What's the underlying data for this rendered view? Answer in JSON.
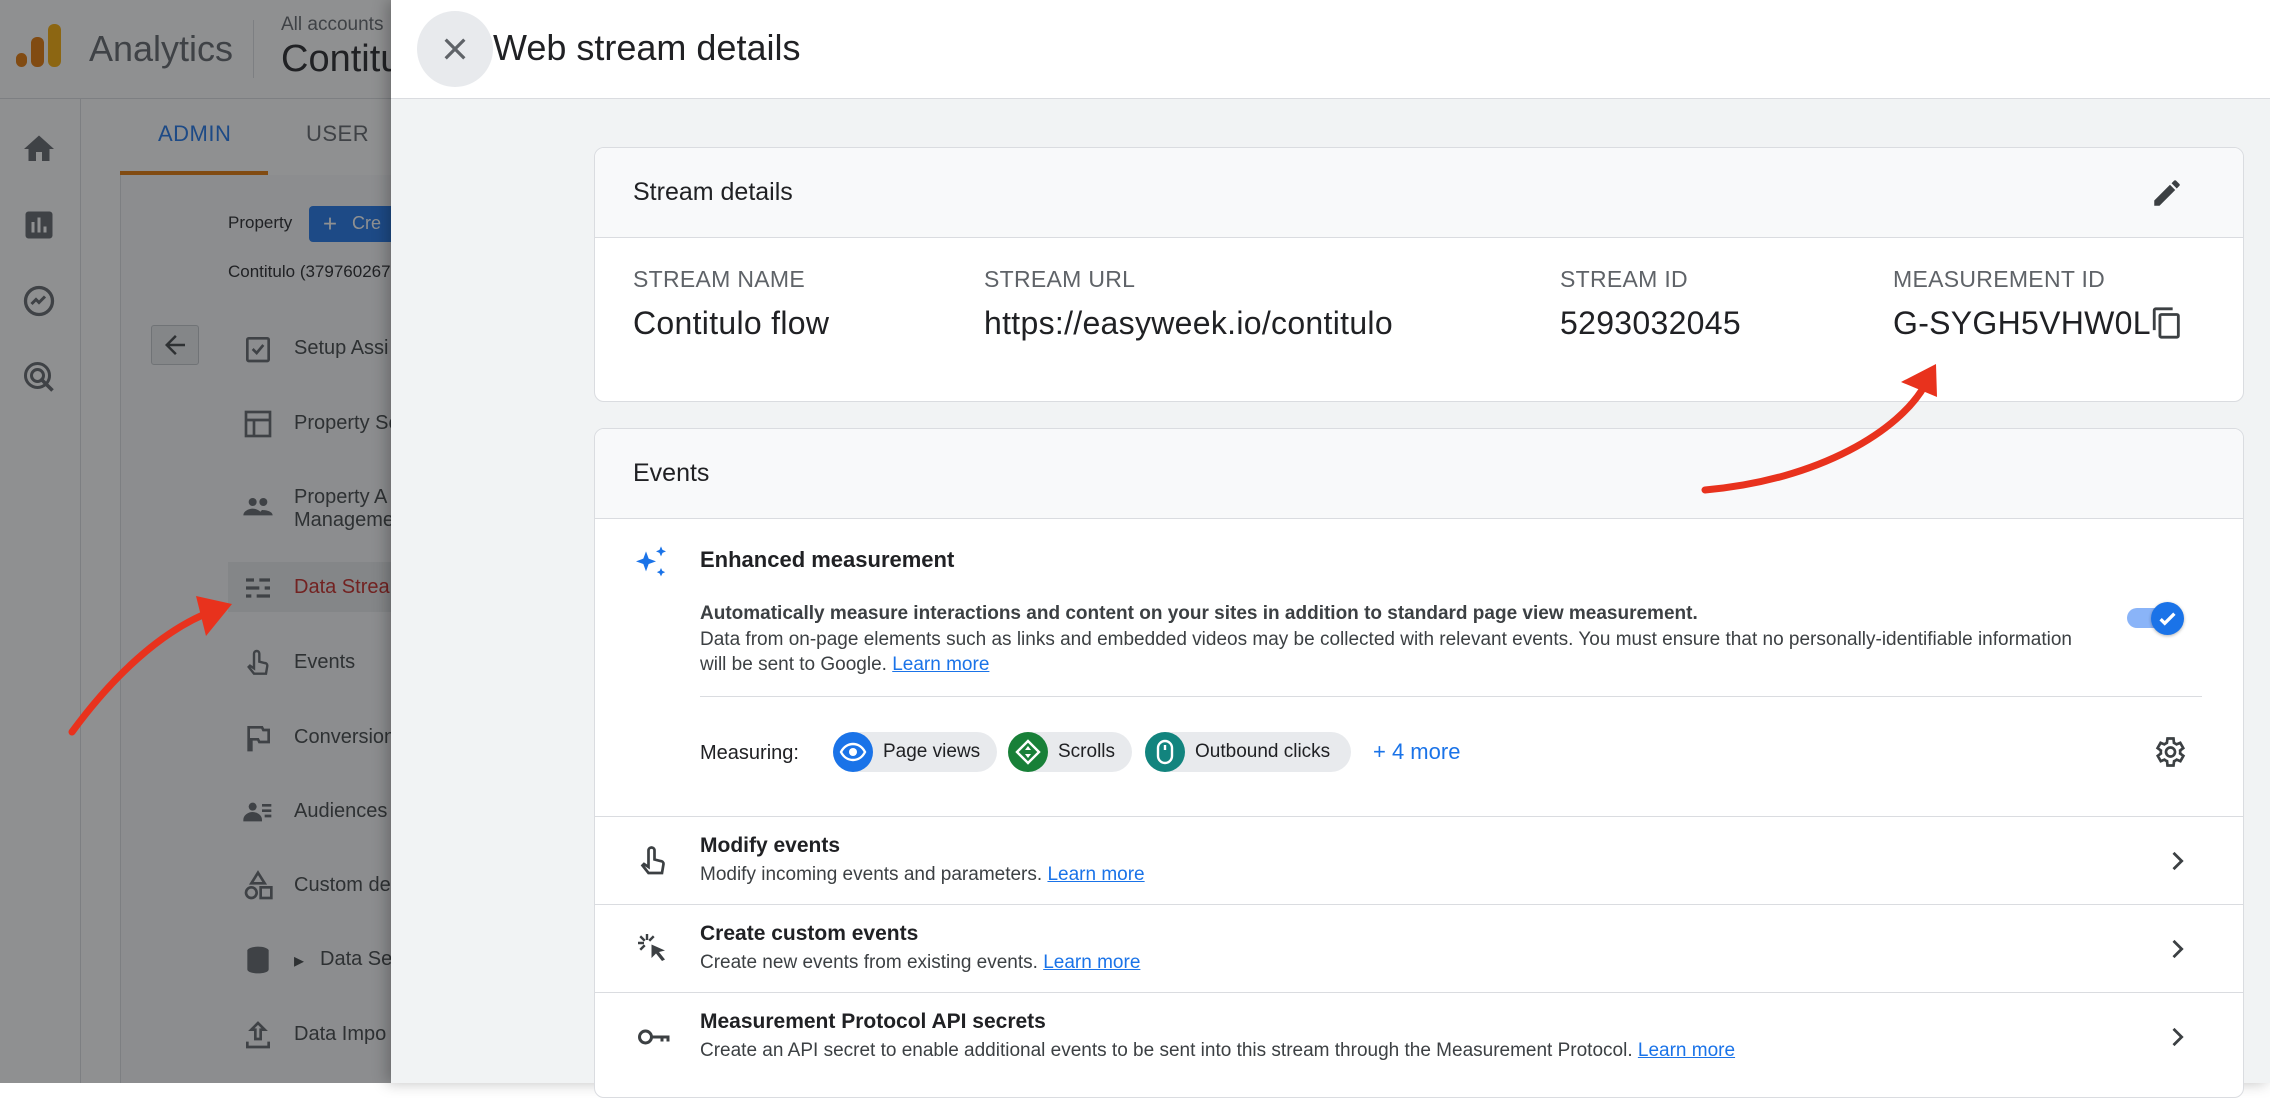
{
  "app": {
    "name": "Analytics",
    "account_label": "All accounts",
    "account_name": "Contitulo"
  },
  "admin_tabs": {
    "admin": "ADMIN",
    "user": "USER"
  },
  "admin_panel": {
    "property_label": "Property",
    "create_label": "Cre",
    "property_select": "Contitulo (379760267",
    "items": [
      {
        "label": "Setup Assi",
        "icon": "checklist-icon"
      },
      {
        "label": "Property Se",
        "icon": "layout-icon"
      },
      {
        "label_line1": "Property A",
        "label_line2": "Manageme",
        "icon": "people-icon"
      },
      {
        "label": "Data Strea",
        "icon": "data-streams-icon"
      },
      {
        "label": "Events",
        "icon": "touch-icon"
      },
      {
        "label": "Conversion",
        "icon": "flag-icon"
      },
      {
        "label": "Audiences",
        "icon": "audience-icon"
      },
      {
        "label": "Custom de",
        "icon": "shapes-icon"
      },
      {
        "label": "Data Se",
        "icon": "database-icon"
      },
      {
        "label": "Data Impo",
        "icon": "upload-icon"
      }
    ]
  },
  "drawer": {
    "title": "Web stream details",
    "stream_details": {
      "title": "Stream details",
      "fields": [
        {
          "label": "STREAM NAME",
          "value": "Contitulo flow"
        },
        {
          "label": "STREAM URL",
          "value": "https://easyweek.io/contitulo"
        },
        {
          "label": "STREAM ID",
          "value": "5293032045"
        },
        {
          "label": "MEASUREMENT ID",
          "value": "G-SYGH5VHW0L"
        }
      ]
    },
    "events": {
      "title": "Events",
      "enhanced": {
        "title": "Enhanced measurement",
        "desc1": "Automatically measure interactions and content on your sites in addition to standard page view measurement.",
        "desc2": "Data from on-page elements such as links and embedded videos may be collected with relevant events. You must ensure that no personally-identifiable information will be sent to Google.",
        "learn_more": "Learn more",
        "enabled": true,
        "measuring_label": "Measuring:",
        "chips": [
          {
            "label": "Page views",
            "icon": "eye-icon",
            "color": "#1a73e8"
          },
          {
            "label": "Scrolls",
            "icon": "scroll-icon",
            "color": "#188038"
          },
          {
            "label": "Outbound clicks",
            "icon": "mouse-icon",
            "color": "#12847e"
          }
        ],
        "more": "+ 4 more"
      },
      "rows": [
        {
          "title": "Modify events",
          "sub": "Modify incoming events and parameters.",
          "learn_more": "Learn more"
        },
        {
          "title": "Create custom events",
          "sub": "Create new events from existing events.",
          "learn_more": "Learn more"
        },
        {
          "title": "Measurement Protocol API secrets",
          "sub": "Create an API secret to enable additional events to be sent into this stream through the Measurement Protocol.",
          "learn_more": "Learn more"
        }
      ]
    }
  },
  "colors": {
    "accent": "#1a73e8",
    "brand_orange": "#e37400",
    "active_red": "#c5221f",
    "annotation_arrow": "#e8321d"
  }
}
